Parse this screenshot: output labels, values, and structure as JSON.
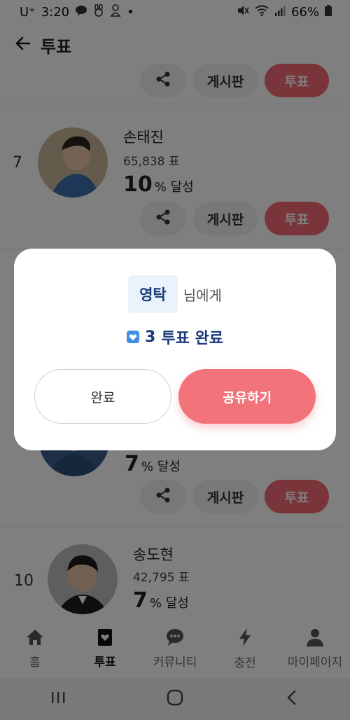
{
  "status_bar": {
    "carrier": "U⁺",
    "time": "3:20",
    "battery": "66%",
    "dot": "•"
  },
  "header": {
    "title": "투표"
  },
  "card_buttons": {
    "board_label": "게시판",
    "vote_label": "투표"
  },
  "candidates": [
    {
      "rank": "7",
      "name": "손태진",
      "votes": "65,838 표",
      "percent": "10",
      "percent_unit": "% 달성"
    },
    {
      "rank": "",
      "name": "",
      "votes": "",
      "percent": "7",
      "percent_unit": "% 달성"
    },
    {
      "rank": "10",
      "name": "송도현",
      "votes": "42,795 표",
      "percent": "7",
      "percent_unit": "% 달성"
    }
  ],
  "modal": {
    "recipient": "영탁",
    "recipient_suffix": "님에게",
    "vote_count": "3",
    "result_text": "투표 완료",
    "done_label": "완료",
    "share_label": "공유하기"
  },
  "bottom_nav": {
    "items": [
      {
        "label": "홈",
        "icon": "home-icon"
      },
      {
        "label": "투표",
        "icon": "vote-icon"
      },
      {
        "label": "커뮤니티",
        "icon": "chat-icon"
      },
      {
        "label": "충전",
        "icon": "bolt-icon"
      },
      {
        "label": "마이페이지",
        "icon": "person-icon"
      }
    ],
    "active_index": 1
  },
  "colors": {
    "accent": "#f2737a",
    "chip_bg": "#eaf2fb",
    "chip_text": "#1a3a7a",
    "heart_badge": "#3f8fe0"
  }
}
